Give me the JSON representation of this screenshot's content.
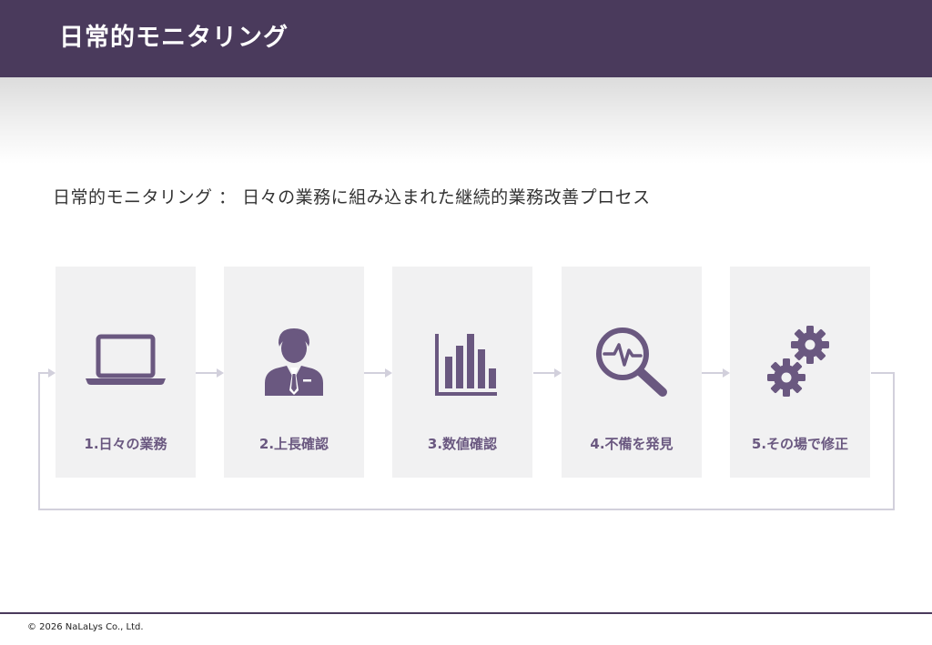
{
  "header": {
    "title": "日常的モニタリング"
  },
  "subtitle": "日常的モニタリング ： 日々の業務に組み込まれた継続的業務改善プロセス",
  "steps": [
    {
      "label": "1.日々の業務",
      "icon": "laptop-icon"
    },
    {
      "label": "2.上長確認",
      "icon": "businessman-icon"
    },
    {
      "label": "3.数値確認",
      "icon": "bar-chart-icon"
    },
    {
      "label": "4.不備を発見",
      "icon": "magnifier-pulse-icon"
    },
    {
      "label": "5.その場で修正",
      "icon": "gears-icon"
    }
  ],
  "footer": {
    "copyright": "© 2026 NaLaLys Co., Ltd."
  },
  "colors": {
    "header_bg": "#4a3a5c",
    "accent": "#6a5880",
    "card_bg": "#f1f1f2",
    "connector": "#d2d0dc"
  }
}
